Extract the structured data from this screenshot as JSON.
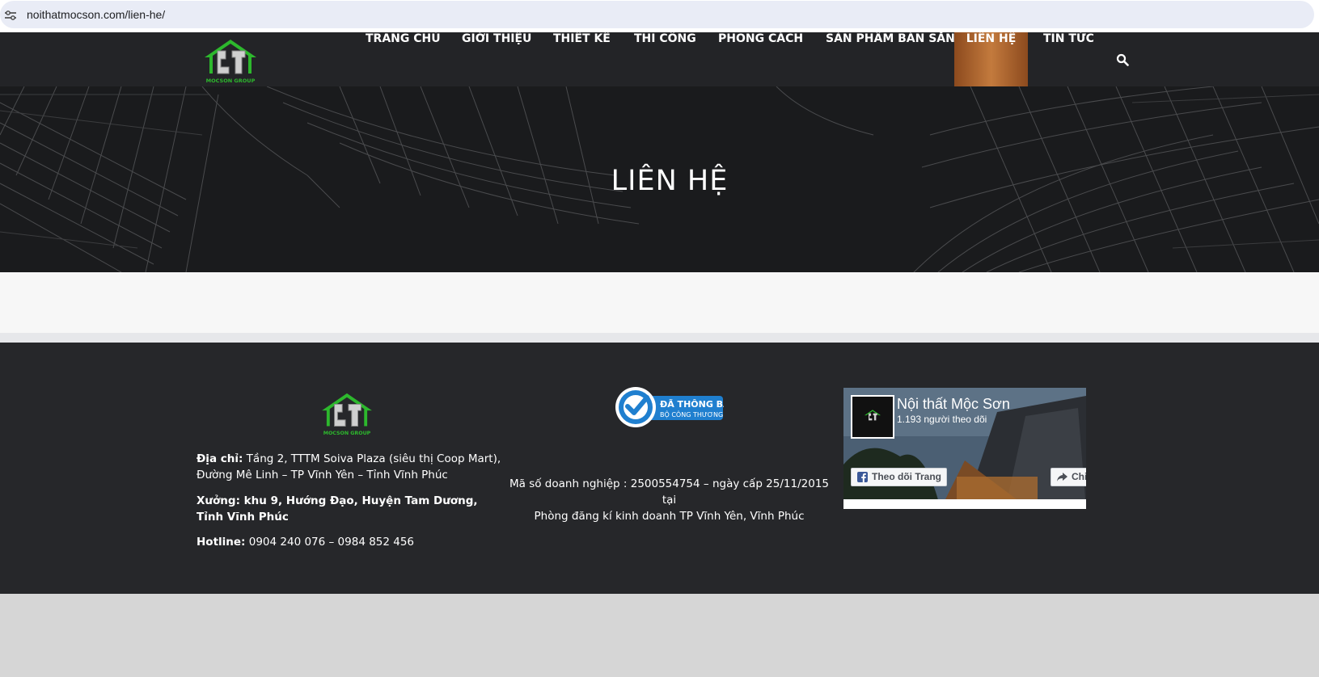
{
  "browser": {
    "url": "noithatmocson.com/lien-he/"
  },
  "brand": {
    "logo_text": "MOCSON GROUP",
    "accent": "#2db82d"
  },
  "nav": {
    "items": [
      {
        "label": "TRANG CHỦ"
      },
      {
        "label": "GIỚI THIỆU"
      },
      {
        "label": "THIẾT KẾ"
      },
      {
        "label": "THI CÔNG"
      },
      {
        "label": "PHONG CÁCH"
      },
      {
        "label": "SẢN PHẨM BÁN SẴN"
      },
      {
        "label": "LIÊN HỆ",
        "active": true
      },
      {
        "label": "TIN TỨC"
      }
    ],
    "search_icon": "search-icon"
  },
  "hero": {
    "title": "LIÊN HỆ"
  },
  "footer": {
    "address_label": "Địa chỉ:",
    "address_value": " Tầng 2, TTTM Soiva Plaza (siêu thị Coop Mart), Đường Mê Linh – TP Vĩnh Yên – Tỉnh Vĩnh Phúc",
    "workshop_label": "Xưởng:",
    "workshop_value": " khu 9, Hướng Đạo, Huyện Tam Dương, Tỉnh Vĩnh Phúc",
    "hotline_label": "Hotline:",
    "hotline_value": " 0904 240 076 – 0984 852 456",
    "badge_title": "ĐÃ THÔNG BÁO",
    "badge_sub": "BỘ CÔNG THƯƠNG",
    "business_line1": "Mã số doanh nghiệp : 2500554754 – ngày cấp 25/11/2015 tại",
    "business_line2": "Phòng đăng kí kinh doanh TP Vĩnh Yên, Vĩnh Phúc"
  },
  "facebook": {
    "page_name": "Nội thất Mộc Sơn",
    "followers": "1.193 người theo dõi",
    "follow_button": "Theo dõi Trang",
    "share_button": "Chia sẻ"
  }
}
